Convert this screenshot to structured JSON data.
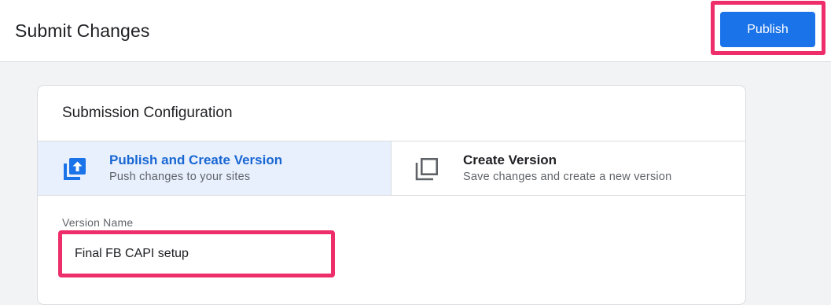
{
  "header": {
    "title": "Submit Changes",
    "publish_label": "Publish"
  },
  "card": {
    "title": "Submission Configuration",
    "options": [
      {
        "title": "Publish and Create Version",
        "description": "Push changes to your sites",
        "icon": "publish-upload-icon",
        "selected": true
      },
      {
        "title": "Create Version",
        "description": "Save changes and create a new version",
        "icon": "copy-layers-icon",
        "selected": false
      }
    ],
    "version_name": {
      "label": "Version Name",
      "value": "Final FB CAPI setup"
    }
  },
  "colors": {
    "accent": "#1a73e8",
    "selected_bg": "#e8f0fe",
    "highlight": "#ee2e6a"
  }
}
